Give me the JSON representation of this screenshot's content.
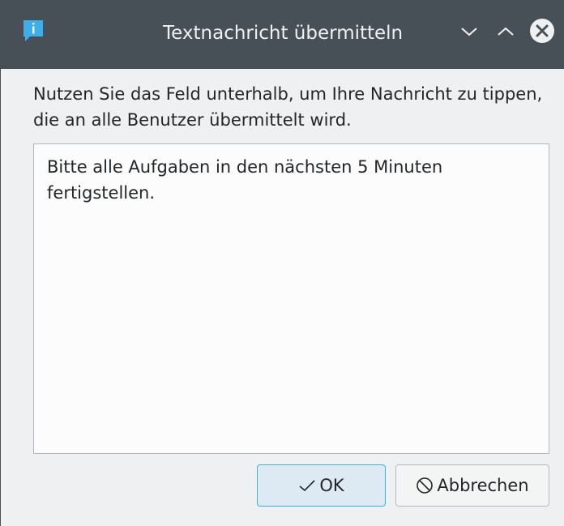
{
  "window": {
    "title": "Textnachricht übermitteln",
    "icons": {
      "app": "message-bubble-icon",
      "minimize": "chevron-down-icon",
      "maximize": "chevron-up-icon",
      "close": "close-circle-icon"
    },
    "colors": {
      "titlebar": "#475057",
      "accent": "#3daee9",
      "app_icon": "#3daee9"
    }
  },
  "dialog": {
    "description": "Nutzen Sie das Feld unterhalb, um Ihre Nachricht zu tippen, die an alle Benutzer übermittelt wird.",
    "message_value": "Bitte alle Aufgaben in den nächsten 5 Minuten\nfertigstellen."
  },
  "buttons": {
    "ok_label": "OK",
    "ok_icon": "checkmark-icon",
    "cancel_label": "Abbrechen",
    "cancel_icon": "cancel-circle-icon"
  }
}
